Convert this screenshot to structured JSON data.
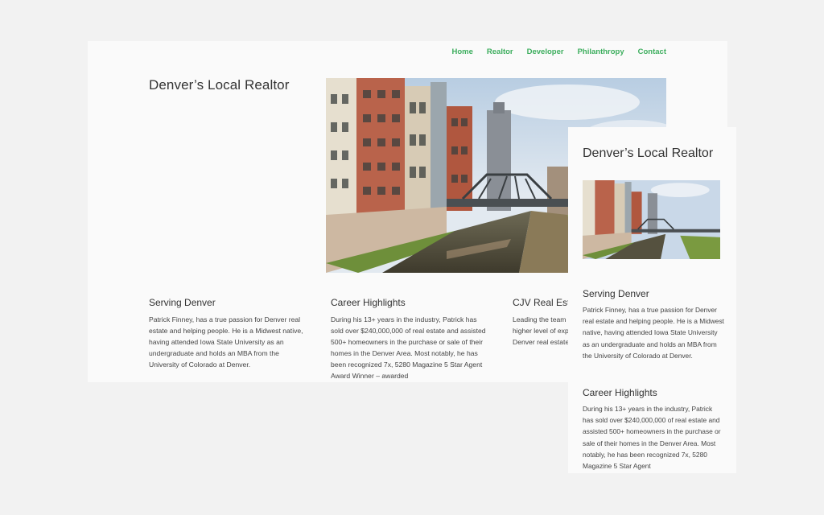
{
  "desktop": {
    "nav": [
      "Home",
      "Realtor",
      "Developer",
      "Philanthropy",
      "Contact"
    ],
    "title": "Denver’s Local Realtor",
    "columns": [
      {
        "heading": "Serving Denver",
        "body": "Patrick Finney, has a true passion for Denver real estate and helping people. He is a Midwest native, having attended Iowa State University as an undergraduate and holds an MBA from the University of Colorado at Denver."
      },
      {
        "heading": "Career Highlights",
        "body": "During his 13+ years in the industry, Patrick has sold over $240,000,000 of real estate and assisted 500+ homeowners in the purchase or sale of their homes in the Denver Area. Most notably, he has been recognized 7x, 5280 Magazine 5 Star Agent Award Winner – awarded"
      },
      {
        "heading": "CJV Real Estate",
        "body": "Leading the team of realtors, CJV Real Estate higher level of expertise working tirelessly the Denver real estate"
      }
    ]
  },
  "mobile": {
    "title": "Denver’s Local Realtor",
    "sections": [
      {
        "heading": "Serving Denver",
        "body": "Patrick Finney, has a true passion for Denver real estate and helping people. He is a Midwest native, having attended Iowa State University as an undergraduate and holds an MBA from the University of Colorado at Denver."
      },
      {
        "heading": "Career Highlights",
        "body": "During his 13+ years in the industry, Patrick has sold over $240,000,000 of real estate and assisted 500+ homeowners in the purchase or sale of their homes in the Denver Area. Most notably, he has been recognized 7x, 5280 Magazine 5 Star Agent"
      }
    ]
  },
  "colors": {
    "accent": "#3dae5e",
    "page_bg": "#f2f2f2",
    "card_bg": "#fafafa"
  }
}
